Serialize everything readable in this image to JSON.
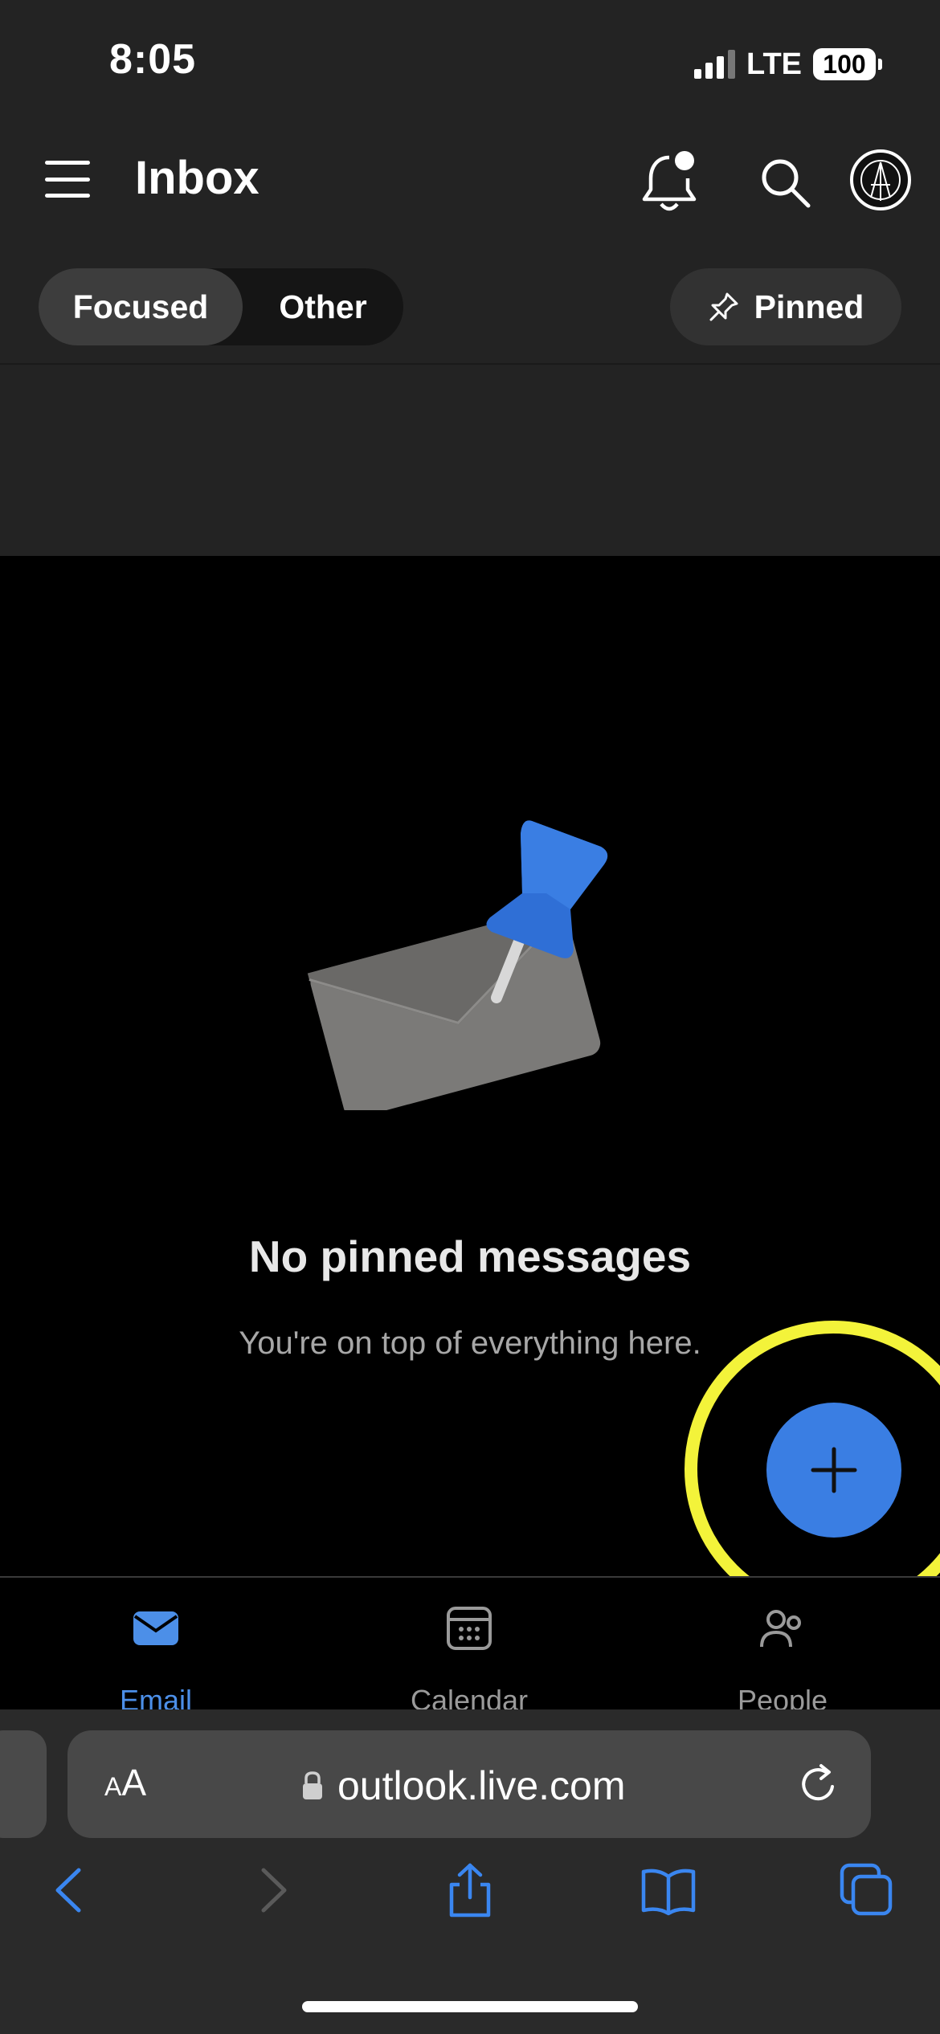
{
  "status_bar": {
    "time": "8:05",
    "network": "LTE",
    "battery": "100"
  },
  "header": {
    "title": "Inbox",
    "icons": [
      "menu-icon",
      "bell-icon",
      "search-icon",
      "avatar"
    ]
  },
  "pivot": {
    "focused_label": "Focused",
    "other_label": "Other",
    "selected": "Focused",
    "pinned_label": "Pinned"
  },
  "empty_state": {
    "title": "No pinned messages",
    "subtitle": "You're on top of everything here."
  },
  "fab": {
    "icon": "plus-icon",
    "highlight_color": "#f3f33a",
    "color": "#3a7ee3"
  },
  "tabbar": {
    "items": [
      {
        "label": "Email",
        "icon": "mail-icon",
        "active": true
      },
      {
        "label": "Calendar",
        "icon": "calendar-icon",
        "active": false
      },
      {
        "label": "People",
        "icon": "people-icon",
        "active": false
      }
    ],
    "active_color": "#4c8fe8"
  },
  "browser": {
    "text_size_label_small": "A",
    "text_size_label_large": "A",
    "url": "outlook.live.com",
    "toolbar_icons": [
      "back-icon",
      "forward-icon",
      "share-icon",
      "bookmarks-icon",
      "tabs-icon"
    ]
  }
}
